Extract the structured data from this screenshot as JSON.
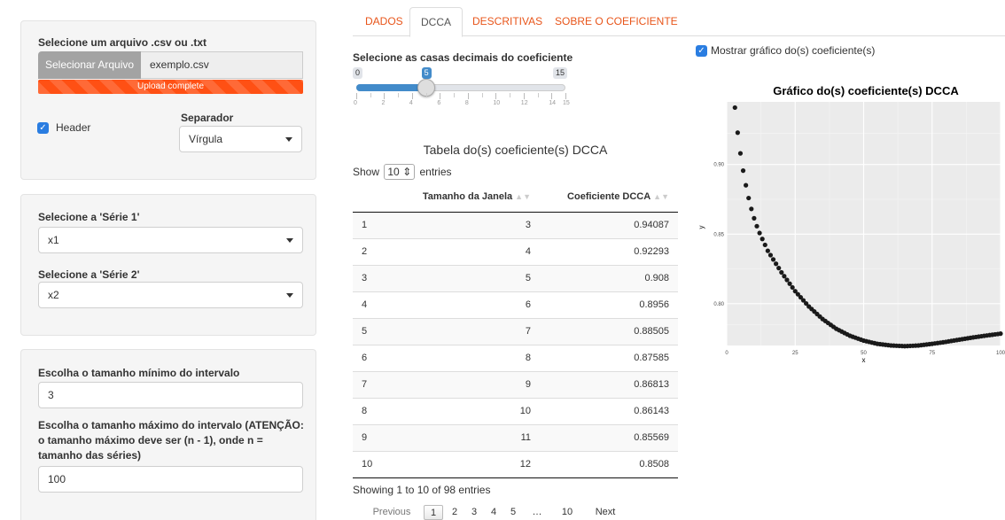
{
  "sidebar": {
    "file_label": "Selecione um arquivo .csv ou .txt",
    "file_button": "Selecionar Arquivo",
    "file_name": "exemplo.csv",
    "upload_status": "Upload complete",
    "header_label": "Header",
    "header_checked": true,
    "separator_label": "Separador",
    "separator_value": "Vírgula",
    "serie1_label": "Selecione a 'Série 1'",
    "serie1_value": "x1",
    "serie2_label": "Selecione a 'Série 2'",
    "serie2_value": "x2",
    "min_label": "Escolha o tamanho mínimo do intervalo",
    "min_value": "3",
    "max_label": "Escolha o tamanho máximo do intervalo (ATENÇÃO: o tamanho máximo deve ser (n - 1), onde n = tamanho das séries)",
    "max_value": "100"
  },
  "tabs": [
    {
      "label": "DADOS",
      "active": false
    },
    {
      "label": "DCCA",
      "active": true
    },
    {
      "label": "DESCRITIVAS",
      "active": false
    },
    {
      "label": "SOBRE O COEFICIENTE",
      "active": false
    }
  ],
  "slider": {
    "label": "Selecione as casas decimais do coeficiente",
    "min": 0,
    "max": 15,
    "value": 5,
    "min_label": "0",
    "max_label": "15",
    "value_label": "5",
    "tick_labels": [
      "0",
      "2",
      "4",
      "6",
      "8",
      "10",
      "12",
      "14",
      "15"
    ]
  },
  "table": {
    "title": "Tabela do(s) coeficiente(s) DCCA",
    "show_prefix": "Show",
    "show_value": "10",
    "show_suffix": "entries",
    "columns": [
      "",
      "Tamanho da Janela",
      "Coeficiente DCCA"
    ],
    "rows": [
      [
        "1",
        "3",
        "0.94087"
      ],
      [
        "2",
        "4",
        "0.92293"
      ],
      [
        "3",
        "5",
        "0.908"
      ],
      [
        "4",
        "6",
        "0.8956"
      ],
      [
        "5",
        "7",
        "0.88505"
      ],
      [
        "6",
        "8",
        "0.87585"
      ],
      [
        "7",
        "9",
        "0.86813"
      ],
      [
        "8",
        "10",
        "0.86143"
      ],
      [
        "9",
        "11",
        "0.85569"
      ],
      [
        "10",
        "12",
        "0.8508"
      ]
    ],
    "info": "Showing 1 to 10 of 98 entries",
    "pager": [
      "Previous",
      "1",
      "2",
      "3",
      "4",
      "5",
      "…",
      "10",
      "Next"
    ],
    "current_page": "1"
  },
  "plot": {
    "checkbox_label": "Mostrar gráfico do(s) coeficiente(s)",
    "checkbox_checked": true,
    "accent": "#2a7de1"
  },
  "chart_data": {
    "type": "scatter",
    "title": "Gráfico do(s) coeficiente(s) DCCA",
    "xlabel": "x",
    "ylabel": "y",
    "xlim": [
      0,
      100
    ],
    "ylim": [
      0.77,
      0.945
    ],
    "xticks": [
      0,
      25,
      50,
      75,
      100
    ],
    "yticks": [
      0.8,
      0.85,
      0.9
    ],
    "ytick_labels": [
      "0.80",
      "0.85",
      "0.90"
    ],
    "xtick_labels": [
      "0",
      "25",
      "50",
      "75",
      "100"
    ],
    "grid": true,
    "curve_points": [
      [
        3,
        0.9409
      ],
      [
        4,
        0.9229
      ],
      [
        5,
        0.908
      ],
      [
        6,
        0.8956
      ],
      [
        7,
        0.8851
      ],
      [
        8,
        0.8759
      ],
      [
        9,
        0.8681
      ],
      [
        10,
        0.8614
      ],
      [
        11,
        0.8557
      ],
      [
        12,
        0.8508
      ],
      [
        15,
        0.838
      ],
      [
        20,
        0.8225
      ],
      [
        25,
        0.809
      ],
      [
        30,
        0.798
      ],
      [
        35,
        0.789
      ],
      [
        40,
        0.782
      ],
      [
        45,
        0.777
      ],
      [
        50,
        0.7735
      ],
      [
        55,
        0.7712
      ],
      [
        60,
        0.77
      ],
      [
        65,
        0.7695
      ],
      [
        70,
        0.77
      ],
      [
        75,
        0.7712
      ],
      [
        80,
        0.7726
      ],
      [
        85,
        0.7742
      ],
      [
        90,
        0.7758
      ],
      [
        95,
        0.7772
      ],
      [
        100,
        0.7785
      ]
    ]
  }
}
